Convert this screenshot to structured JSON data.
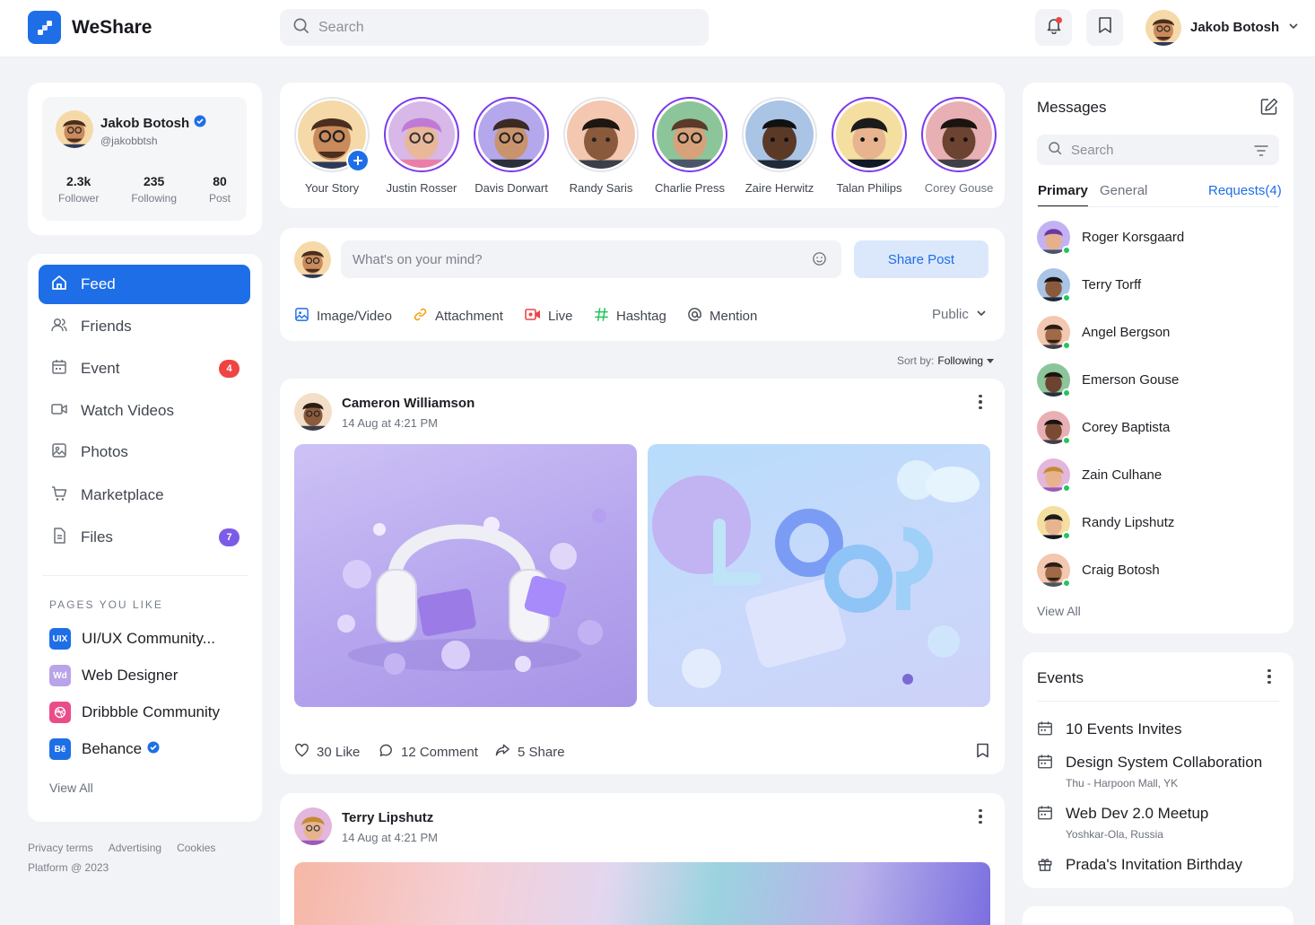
{
  "app": {
    "name": "WeShare",
    "brand_color": "#1e6ee8"
  },
  "header": {
    "search_placeholder": "Search",
    "user_name": "Jakob Botosh",
    "icons": [
      "bell-icon",
      "bookmark-icon",
      "chevron-down-icon"
    ]
  },
  "profile": {
    "name": "Jakob Botosh",
    "handle": "@jakobbtsh",
    "stats": [
      {
        "value": "2.3k",
        "label": "Follower"
      },
      {
        "value": "235",
        "label": "Following"
      },
      {
        "value": "80",
        "label": "Post"
      }
    ]
  },
  "nav": {
    "items": [
      {
        "label": "Feed",
        "icon": "home-icon",
        "active": true
      },
      {
        "label": "Friends",
        "icon": "users-icon"
      },
      {
        "label": "Event",
        "icon": "calendar-icon",
        "badge": "4",
        "badge_color": "#ef4444"
      },
      {
        "label": "Watch Videos",
        "icon": "video-icon"
      },
      {
        "label": "Photos",
        "icon": "image-icon"
      },
      {
        "label": "Marketplace",
        "icon": "cart-icon"
      },
      {
        "label": "Files",
        "icon": "file-icon",
        "badge": "7",
        "badge_color": "#7c5ce6"
      }
    ]
  },
  "pages": {
    "title": "PAGES YOU LIKE",
    "items": [
      {
        "label": "UI/UX Community...",
        "icon_text": "UIX",
        "color": "#1e6ee8"
      },
      {
        "label": "Web Designer",
        "icon_text": "Wd",
        "color": "#b9a4ea"
      },
      {
        "label": "Dribbble Community",
        "icon_text": "",
        "color": "#ea4c89"
      },
      {
        "label": "Behance",
        "icon_text": "Bē",
        "color": "#1e6ee8",
        "verified": true
      }
    ],
    "view_all": "View All"
  },
  "footer": {
    "links": [
      "Privacy terms",
      "Advertising",
      "Cookies"
    ],
    "copyright": "Platform @ 2023"
  },
  "stories": [
    {
      "name": "Your Story",
      "own": true
    },
    {
      "name": "Justin Rosser"
    },
    {
      "name": "Davis Dorwart"
    },
    {
      "name": "Randy Saris"
    },
    {
      "name": "Charlie Press"
    },
    {
      "name": "Zaire Herwitz"
    },
    {
      "name": "Talan Philips"
    },
    {
      "name": "Corey Gouse"
    }
  ],
  "composer": {
    "placeholder": "What's on your mind?",
    "share_label": "Share Post",
    "actions": [
      {
        "label": "Image/Video",
        "icon": "image-icon",
        "color": "#1e6ee8"
      },
      {
        "label": "Attachment",
        "icon": "link-icon",
        "color": "#f59e0b"
      },
      {
        "label": "Live",
        "icon": "live-icon",
        "color": "#ef4444"
      },
      {
        "label": "Hashtag",
        "icon": "hashtag-icon",
        "color": "#22c55e"
      },
      {
        "label": "Mention",
        "icon": "at-icon",
        "color": "#41464f"
      }
    ],
    "visibility": "Public"
  },
  "sort": {
    "label": "Sort by:",
    "value": "Following"
  },
  "posts": [
    {
      "author": "Cameron Williamson",
      "time": "14 Aug at 4:21 PM",
      "likes": "30 Like",
      "comments": "12 Comment",
      "shares": "5 Share"
    },
    {
      "author": "Terry Lipshutz",
      "time": "14 Aug at 4:21 PM"
    }
  ],
  "messages": {
    "title": "Messages",
    "search_placeholder": "Search",
    "tabs": [
      "Primary",
      "General"
    ],
    "requests": "Requests(4)",
    "contacts": [
      "Roger Korsgaard",
      "Terry Torff",
      "Angel Bergson",
      "Emerson Gouse",
      "Corey Baptista",
      "Zain Culhane",
      "Randy Lipshutz",
      "Craig Botosh"
    ],
    "view_all": "View All"
  },
  "events": {
    "title": "Events",
    "items": [
      {
        "title": "10 Events Invites",
        "sub": "",
        "icon": "calendar-icon"
      },
      {
        "title": "Design System Collaboration",
        "sub": "Thu - Harpoon Mall, YK",
        "icon": "calendar-icon"
      },
      {
        "title": "Web Dev 2.0 Meetup",
        "sub": "Yoshkar-Ola, Russia",
        "icon": "calendar-icon"
      },
      {
        "title": "Prada's Invitation Birthday",
        "sub": "",
        "icon": "gift-icon"
      }
    ]
  }
}
